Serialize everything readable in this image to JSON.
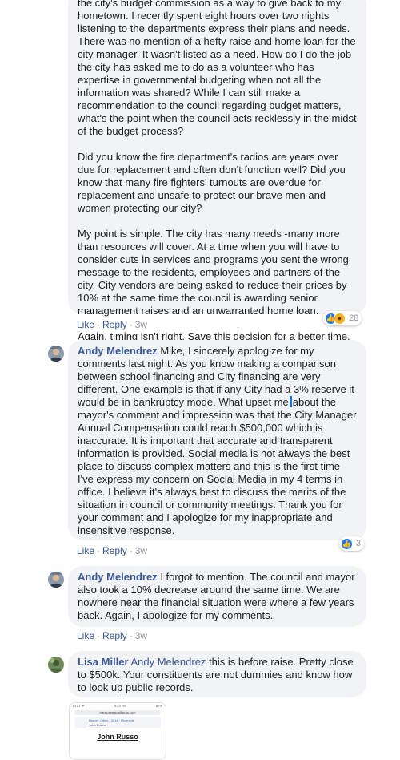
{
  "first_comment": {
    "para1_lead": "the city's budget commission as a way to give back to my",
    "para1": "hometown. I recently spent eight hours over two nights listening to the departments express their plans and needs. There was no mention of a hefty raise and home loan for the city manager. It wasn't listed as a need. How do I do the job the city has asked me to do as a volunteer who has expertise in governmental budgeting when not all the information was shared? While I can still make a recommendation to the council regarding budget matters, what's the point when the council acts recklessly in the midst of the budget process?",
    "para2": "Did you know the fire department's radios are years over due for replacement and often don't function well? Did you know that many fire fighters' turnouts are overdue for replacement and unsafe to protect our brave men and women protecting our city?",
    "para3": "My point is simple. The city has many needs -many more than resources will cover. At a time when you will have to consider cuts in services and programs you sent the wrong message to the residents, employees and partners of the city. City vendors are being asked to reduce their prices by 10% at the same time the council is awarding senior management raises and an unwarranted home loan.",
    "para4": "Again, timing isn't right. Save this decision for a better time.",
    "reactions_count": "28",
    "reaction_icons": [
      "like-icon",
      "wow-icon"
    ]
  },
  "actions": {
    "like": "Like",
    "reply": "Reply",
    "separator": "·"
  },
  "comments": [
    {
      "author": "Andy Melendrez",
      "text_before_cursor": "Mike, I sincerely apologize for my comments last night. As you know making a comparison between school financing and City financing are very different. One example is that if any City had a 3% reserve it would be in bankruptcy mode. What upset me",
      "text_after_cursor": "about the mayor's comment and impression was that the City Manager Annual Compensation could reach $500,000 which is inaccurate. It is important that accurate and transparent information is provided. Social media is not always the best place to discuss complex matters and this is the first time I've express my concern on Social Media in my 4 terms in office. I believe it's always best to discuss the merits of the situation in council or community meetings. Thank you for your comment and I apologize for my inappropriate and insensitive response.",
      "time": "3w",
      "reactions_count": "3"
    },
    {
      "author": "Andy Melendrez",
      "text": "I forgot to mention. The council and mayor also took a 10% decrease around the same time. We are nowhere near the financial situation were where a few years back. Again, I apologize for my comments.",
      "time": "3w"
    },
    {
      "author": "Lisa Miller",
      "mention": "Andy Melendrez",
      "text": "this is before raise. Pretty close to $500k. Your constituents are not dummies and know how to look up public records."
    }
  ],
  "first_time": "3w",
  "attachment": {
    "status_left": "AT&T ᯤ",
    "status_time": "9:23 PM",
    "status_right": "87%",
    "url": "transparentcalifornia.com",
    "crumbs": [
      "Home",
      "Cities",
      "2016",
      "Riverside"
    ],
    "crumb_sub": "John Russo",
    "heading": "John Russo"
  }
}
